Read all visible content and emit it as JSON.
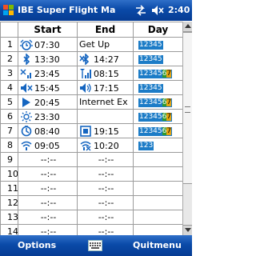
{
  "titlebar": {
    "title": "IBE Super Flight Ma",
    "time": "2:40",
    "icons": [
      "windows-flag-icon",
      "connectivity-arrows-icon",
      "speaker-muted-icon"
    ]
  },
  "table": {
    "headers": [
      "",
      "Start",
      "End",
      "Day"
    ],
    "rows": [
      {
        "num": "1",
        "start_icon": "alarm-clock-icon",
        "start": "07:30",
        "end_icon": "",
        "end": "Get Up",
        "days": "12345",
        "weekend6": false,
        "weekend7": false
      },
      {
        "num": "2",
        "start_icon": "bluetooth-icon",
        "start": "13:30",
        "end_icon": "bluetooth-off-icon",
        "end": "14:27",
        "days": "12345",
        "weekend6": false,
        "weekend7": false
      },
      {
        "num": "3",
        "start_icon": "phone-off-icon",
        "start": "23:45",
        "end_icon": "signal-bars-icon",
        "end": "08:15",
        "days": "12345",
        "weekend6": true,
        "weekend7": true
      },
      {
        "num": "4",
        "start_icon": "speaker-muted-icon",
        "start": "15:45",
        "end_icon": "speaker-icon",
        "end": "17:15",
        "days": "12345",
        "weekend6": false,
        "weekend7": false
      },
      {
        "num": "5",
        "start_icon": "play-icon",
        "start": "20:45",
        "end_icon": "",
        "end": "Internet Ex",
        "days": "12345",
        "weekend6": true,
        "weekend7": true
      },
      {
        "num": "6",
        "start_icon": "brightness-icon",
        "start": "23:30",
        "end_icon": "",
        "end": "",
        "days": "12345",
        "weekend6": true,
        "weekend7": true
      },
      {
        "num": "7",
        "start_icon": "power-timer-icon",
        "start": "08:40",
        "end_icon": "screen-icon",
        "end": "19:15",
        "days": "12345",
        "weekend6": true,
        "weekend7": true
      },
      {
        "num": "8",
        "start_icon": "wifi-icon",
        "start": "09:05",
        "end_icon": "wifi-off-icon",
        "end": "10:20",
        "days": "123",
        "weekend6": false,
        "weekend7": false
      },
      {
        "num": "9",
        "start_icon": "",
        "start": "--:--",
        "end_icon": "",
        "end": "--:--",
        "days": "",
        "weekend6": false,
        "weekend7": false
      },
      {
        "num": "10",
        "start_icon": "",
        "start": "--:--",
        "end_icon": "",
        "end": "--:--",
        "days": "",
        "weekend6": false,
        "weekend7": false
      },
      {
        "num": "11",
        "start_icon": "",
        "start": "--:--",
        "end_icon": "",
        "end": "--:--",
        "days": "",
        "weekend6": false,
        "weekend7": false
      },
      {
        "num": "12",
        "start_icon": "",
        "start": "--:--",
        "end_icon": "",
        "end": "--:--",
        "days": "",
        "weekend6": false,
        "weekend7": false
      },
      {
        "num": "13",
        "start_icon": "",
        "start": "--:--",
        "end_icon": "",
        "end": "--:--",
        "days": "",
        "weekend6": false,
        "weekend7": false
      },
      {
        "num": "14",
        "start_icon": "",
        "start": "--:--",
        "end_icon": "",
        "end": "--:--",
        "days": "",
        "weekend6": false,
        "weekend7": false
      }
    ]
  },
  "menubar": {
    "left": "Options",
    "right": "Quitmenu",
    "center_icon": "keyboard-icon"
  },
  "colors": {
    "titlebar": "#0a4aa8",
    "days_badge": "#1c7cc7",
    "day6": "#2e9a2e",
    "day7": "#e3a310",
    "icon_blue": "#1565c0"
  }
}
